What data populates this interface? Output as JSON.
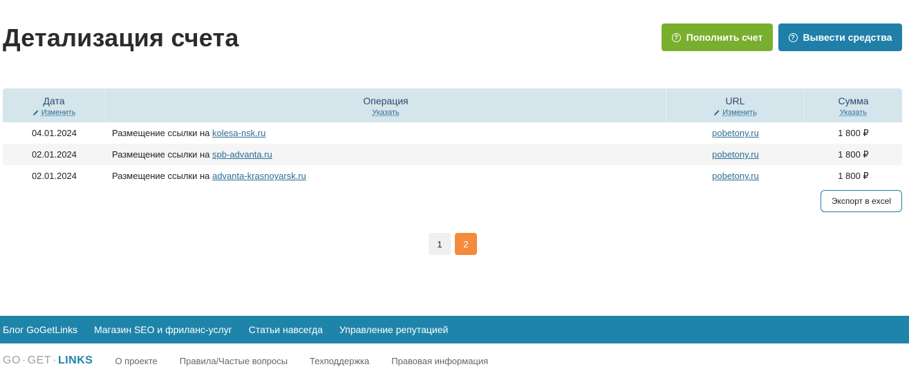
{
  "page": {
    "title": "Детализация счета"
  },
  "actions": {
    "topup_label": "Пополнить счет",
    "withdraw_label": "Вывести средства",
    "topup_color": "#79af2f",
    "withdraw_color": "#1f7fa8"
  },
  "table": {
    "columns": [
      {
        "title": "Дата",
        "action": "Изменить",
        "icon": "pencil-icon"
      },
      {
        "title": "Операция",
        "action": "Указать"
      },
      {
        "title": "URL",
        "action": "Изменить",
        "icon": "pencil-icon"
      },
      {
        "title": "Сумма",
        "action": "Указать"
      }
    ],
    "rows": [
      {
        "date": "04.01.2024",
        "op_text": "Размещение ссылки на",
        "op_link": "kolesa-nsk.ru",
        "url": "pobetony.ru",
        "sum": "1 800 ₽"
      },
      {
        "date": "02.01.2024",
        "op_text": "Размещение ссылки на",
        "op_link": "spb-advanta.ru",
        "url": "pobetony.ru",
        "sum": "1 800 ₽"
      },
      {
        "date": "02.01.2024",
        "op_text": "Размещение ссылки на",
        "op_link": "advanta-krasnoyarsk.ru",
        "url": "pobetony.ru",
        "sum": "1 800 ₽"
      }
    ],
    "export_label": "Экспорт в excel"
  },
  "pagination": {
    "pages": [
      "1",
      "2"
    ],
    "current": "2",
    "active_color": "#f28c3c"
  },
  "footer": {
    "bar_links": [
      "Блог GoGetLinks",
      "Магазин SEO и фриланс-услуг",
      "Статьи навсегда",
      "Управление репутацией"
    ],
    "logo": {
      "part1": "GO",
      "sep1": "·",
      "part2": "GET",
      "sep2": "·",
      "part3": "LINKS"
    },
    "links": [
      "О проекте",
      "Правила/Частые вопросы",
      "Техподдержка",
      "Правовая информация"
    ],
    "bar_color": "#1f84aa"
  }
}
